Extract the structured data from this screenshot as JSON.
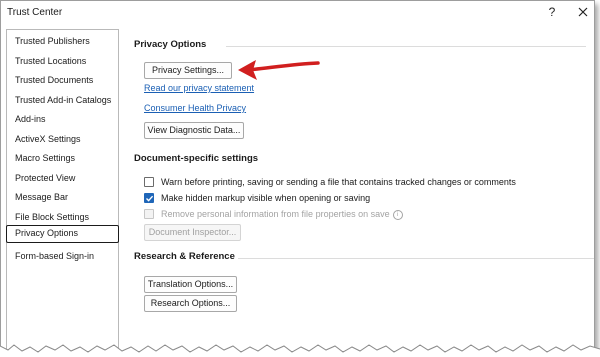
{
  "window": {
    "title": "Trust Center",
    "help_glyph": "?",
    "close_icon": "close-icon"
  },
  "sidebar": {
    "items": [
      {
        "label": "Trusted Publishers"
      },
      {
        "label": "Trusted Locations"
      },
      {
        "label": "Trusted Documents"
      },
      {
        "label": "Trusted Add-in Catalogs"
      },
      {
        "label": "Add-ins"
      },
      {
        "label": "ActiveX Settings"
      },
      {
        "label": "Macro Settings"
      },
      {
        "label": "Protected View"
      },
      {
        "label": "Message Bar"
      },
      {
        "label": "File Block Settings"
      },
      {
        "label": "Privacy Options",
        "selected": true
      },
      {
        "label": "Form-based Sign-in"
      }
    ]
  },
  "privacy": {
    "heading": "Privacy Options",
    "settings_button": "Privacy Settings...",
    "read_statement_link": "Read our privacy statement",
    "consumer_health_link": "Consumer Health Privacy",
    "diagnostic_button": "View Diagnostic Data..."
  },
  "document_settings": {
    "heading": "Document-specific settings",
    "options": [
      {
        "label": "Warn before printing, saving or sending a file that contains tracked changes or comments",
        "checked": false,
        "disabled": false
      },
      {
        "label": "Make hidden markup visible when opening or saving",
        "checked": true,
        "disabled": false
      },
      {
        "label": "Remove personal information from file properties on save",
        "checked": false,
        "disabled": true
      }
    ],
    "inspector_button": "Document Inspector..."
  },
  "research": {
    "heading": "Research & Reference",
    "translation_button": "Translation Options...",
    "research_button": "Research Options..."
  },
  "colors": {
    "accent": "#1f66b8",
    "link": "#1a5fb4",
    "annotation_arrow": "#d11f1f"
  }
}
